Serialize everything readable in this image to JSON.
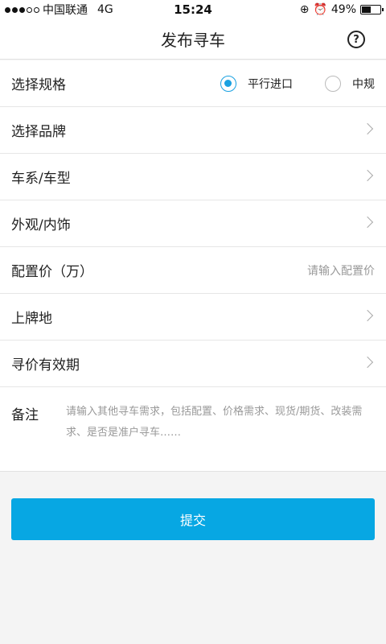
{
  "status_bar": {
    "carrier": "中国联通",
    "network": "4G",
    "time": "15:24",
    "battery": "49%",
    "battery_level": 0.49
  },
  "header": {
    "title": "发布寻车",
    "help_icon": "?"
  },
  "form": {
    "spec": {
      "label": "选择规格",
      "options": [
        "平行进口",
        "中规"
      ],
      "selected": "平行进口"
    },
    "brand_label": "选择品牌",
    "series_label": "车系/车型",
    "appearance_label": "外观/内饰",
    "price": {
      "label": "配置价（万）",
      "placeholder": "请输入配置价"
    },
    "plate_label": "上牌地",
    "validity_label": "寻价有效期",
    "note": {
      "label": "备注",
      "placeholder": "请输入其他寻车需求，包括配置、价格需求、现货/期货、改装需求、是否是准户寻车……"
    }
  },
  "submit_label": "提交",
  "colors": {
    "accent": "#07a7e3",
    "radio_checked": "#1aa1e1"
  }
}
